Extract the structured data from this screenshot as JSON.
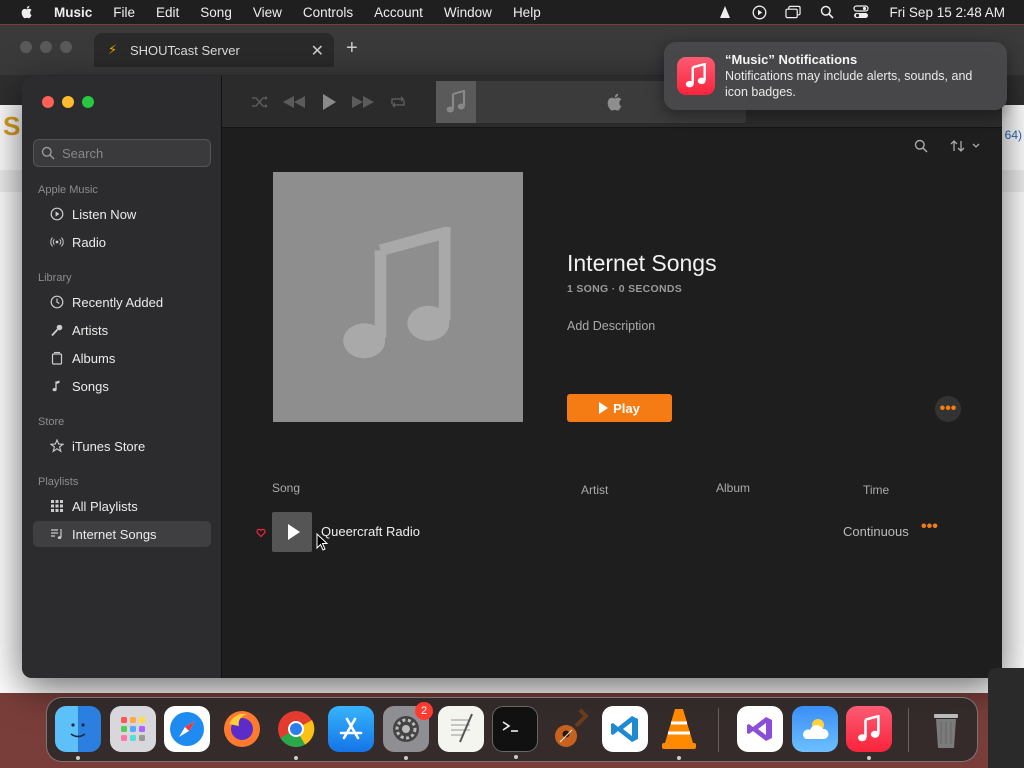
{
  "menubar": {
    "items": [
      "Music",
      "File",
      "Edit",
      "Song",
      "View",
      "Controls",
      "Account",
      "Window",
      "Help"
    ],
    "clock": "Fri Sep 15  2:48 AM"
  },
  "browser": {
    "tab_title": "SHOUTcast Server",
    "new_tab": "+",
    "close": "✕",
    "page_letter": "S",
    "page_fragment": "64)"
  },
  "sidebar": {
    "search_placeholder": "Search",
    "sections": [
      {
        "label": "Apple Music",
        "items": [
          {
            "label": "Listen Now",
            "icon": "play-circle-icon"
          },
          {
            "label": "Radio",
            "icon": "radio-waves-icon"
          }
        ]
      },
      {
        "label": "Library",
        "items": [
          {
            "label": "Recently Added",
            "icon": "clock-icon"
          },
          {
            "label": "Artists",
            "icon": "microphone-icon"
          },
          {
            "label": "Albums",
            "icon": "album-icon"
          },
          {
            "label": "Songs",
            "icon": "music-note-icon"
          }
        ]
      },
      {
        "label": "Store",
        "items": [
          {
            "label": "iTunes Store",
            "icon": "star-icon"
          }
        ]
      },
      {
        "label": "Playlists",
        "items": [
          {
            "label": "All Playlists",
            "icon": "grid-icon"
          },
          {
            "label": "Internet Songs",
            "icon": "playlist-icon"
          }
        ]
      }
    ],
    "selected": "Internet Songs"
  },
  "playlist": {
    "title": "Internet Songs",
    "meta": "1 SONG · 0 SECONDS",
    "description": "Add Description",
    "play_label": "Play",
    "more": "•••"
  },
  "columns": {
    "song": "Song",
    "artist": "Artist",
    "album": "Album",
    "time": "Time"
  },
  "tracks": [
    {
      "name": "Queercraft Radio",
      "time": "Continuous",
      "more": "•••"
    }
  ],
  "notification": {
    "title": "“Music” Notifications",
    "body": "Notifications may include alerts, sounds, and icon badges."
  },
  "dock": {
    "apps": [
      "Finder",
      "Launchpad",
      "Safari",
      "Firefox",
      "Chrome",
      "App Store",
      "System Settings",
      "TextEdit",
      "Terminal",
      "GarageBand",
      "VS Code",
      "VLC",
      "Visual Studio",
      "Weather",
      "Music",
      "Trash"
    ],
    "settings_badge": "2"
  },
  "colors": {
    "accent": "#f57c14",
    "music_red": "#fa233b"
  }
}
